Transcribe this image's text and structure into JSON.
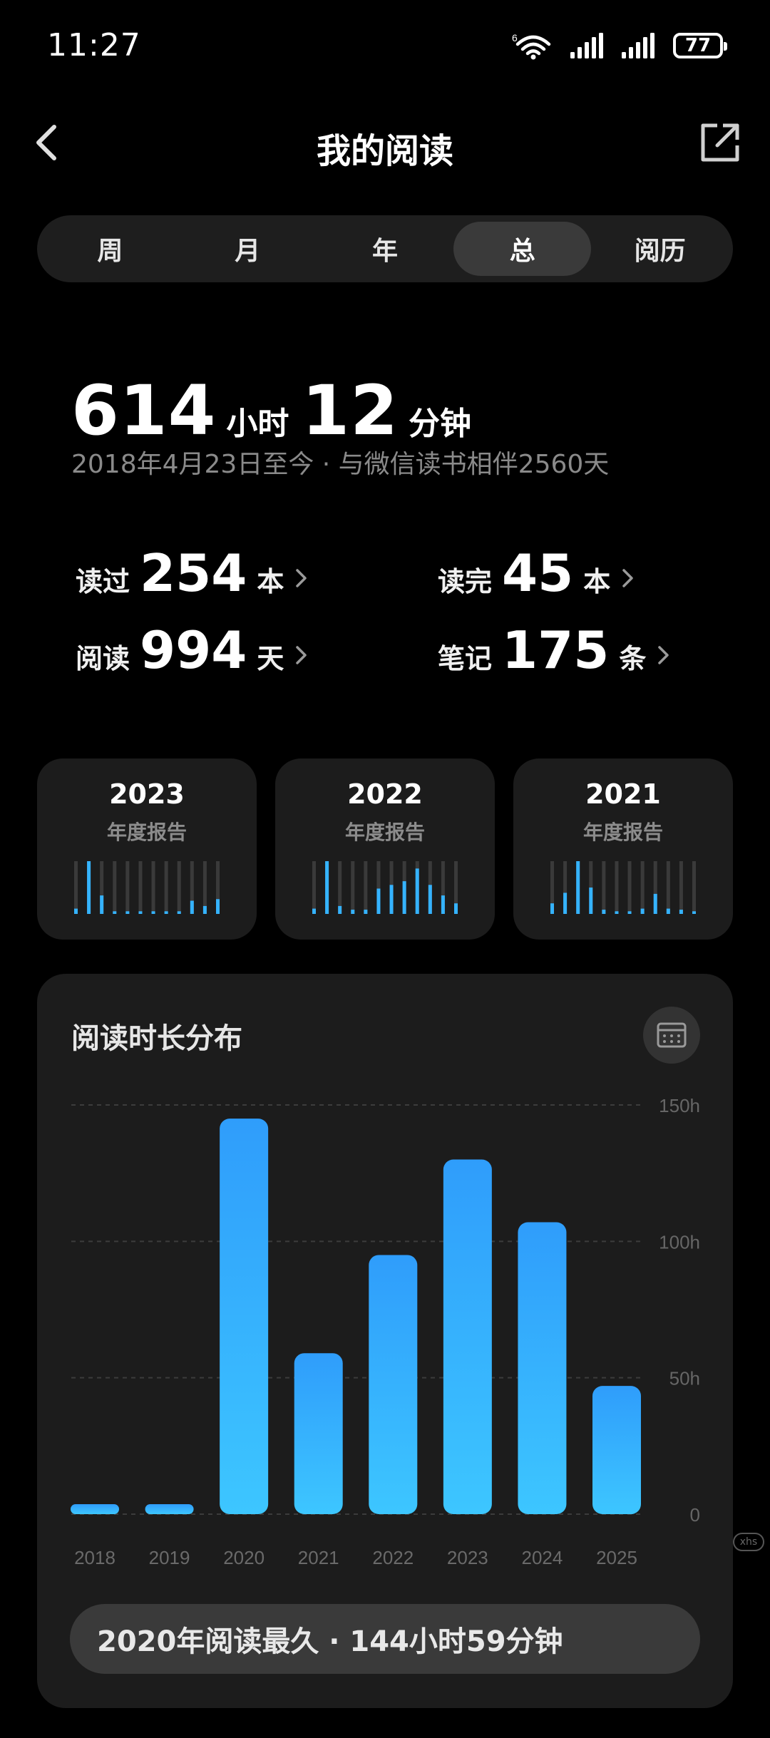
{
  "status_bar": {
    "time": "11:27",
    "wifi_badge": "6",
    "battery": "77",
    "icons": [
      "wifi-icon",
      "signal-icon",
      "signal-icon",
      "battery-icon"
    ]
  },
  "nav": {
    "title": "我的阅读",
    "back_icon": "chevron-left-icon",
    "share_icon": "share-icon"
  },
  "tabs": [
    {
      "label": "周",
      "active": false
    },
    {
      "label": "月",
      "active": false
    },
    {
      "label": "年",
      "active": false
    },
    {
      "label": "总",
      "active": true
    },
    {
      "label": "阅历",
      "active": false
    }
  ],
  "summary": {
    "hours": "614",
    "hours_unit": "小时",
    "minutes": "12",
    "minutes_unit": "分钟",
    "since": "2018年4月23日至今 · 与微信读书相伴2560天"
  },
  "stats": [
    {
      "label": "读过",
      "value": "254",
      "unit": "本"
    },
    {
      "label": "读完",
      "value": "45",
      "unit": "本"
    },
    {
      "label": "阅读",
      "value": "994",
      "unit": "天"
    },
    {
      "label": "笔记",
      "value": "175",
      "unit": "条"
    }
  ],
  "year_reports": [
    {
      "year": "2023",
      "label": "年度报告",
      "monthly": [
        0.1,
        1.0,
        0.35,
        0.05,
        0.05,
        0.05,
        0.05,
        0.05,
        0.05,
        0.25,
        0.15,
        0.28
      ]
    },
    {
      "year": "2022",
      "label": "年度报告",
      "monthly": [
        0.1,
        1.0,
        0.15,
        0.08,
        0.08,
        0.48,
        0.55,
        0.62,
        0.86,
        0.55,
        0.35,
        0.2
      ]
    },
    {
      "year": "2021",
      "label": "年度报告",
      "monthly": [
        0.2,
        0.4,
        1.0,
        0.5,
        0.08,
        0.05,
        0.05,
        0.1,
        0.38,
        0.1,
        0.08,
        0.05
      ]
    }
  ],
  "distribution": {
    "title": "阅读时长分布",
    "calendar_icon": "calendar-icon",
    "highlight": "2020年阅读最久 · 144小时59分钟"
  },
  "chart_data": {
    "type": "bar",
    "categories": [
      "2018",
      "2019",
      "2020",
      "2021",
      "2022",
      "2023",
      "2024",
      "2025"
    ],
    "values": [
      3,
      3,
      145,
      59,
      95,
      130,
      107,
      47
    ],
    "y_ticks": [
      "0",
      "50h",
      "100h",
      "150h"
    ],
    "ylim": [
      0,
      150
    ],
    "grid": true,
    "bar_color": "#35b3ff"
  },
  "colors": {
    "background": "#000000",
    "card": "#1c1c1c",
    "accent": "#35b3ff",
    "mini_bar_inactive": "#3a3a3a"
  },
  "watermark": "小红书"
}
